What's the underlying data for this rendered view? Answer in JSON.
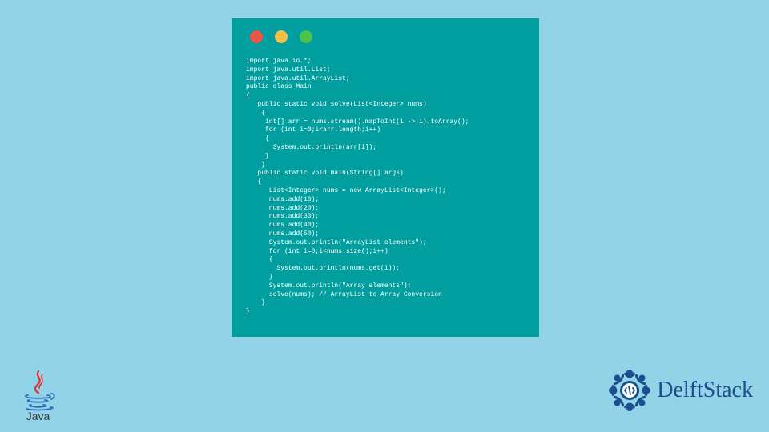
{
  "code": {
    "lines": [
      "import java.io.*;",
      "import java.util.List;",
      "import java.util.ArrayList;",
      "public class Main",
      "{",
      "   public static void solve(List<Integer> nums)",
      "    {",
      "     int[] arr = nums.stream().mapToInt(i -> i).toArray();",
      "     for (int i=0;i<arr.length;i++)",
      "     {",
      "       System.out.println(arr[i]);",
      "     }",
      "    }",
      "   public static void main(String[] args)",
      "   {",
      "      List<Integer> nums = new ArrayList<Integer>();",
      "      nums.add(10);",
      "      nums.add(20);",
      "      nums.add(30);",
      "      nums.add(40);",
      "      nums.add(50);",
      "      System.out.println(\"ArrayList elements\");",
      "      for (int i=0;i<nums.size();i++)",
      "      {",
      "        System.out.println(nums.get(i));",
      "      }",
      "      System.out.println(\"Array elements\");",
      "      solve(nums); // ArrayList to Array Conversion",
      "    }",
      "}"
    ]
  },
  "logos": {
    "java_label": "Java",
    "delft_label": "DelftStack"
  },
  "colors": {
    "bg": "#93d3e8",
    "window": "#009e9e",
    "red": "#ed5346",
    "yellow": "#f7c047",
    "green": "#4bc24b",
    "delft_blue": "#1b4f8f",
    "java_red": "#e32b2b",
    "java_blue": "#2d6eb5"
  }
}
